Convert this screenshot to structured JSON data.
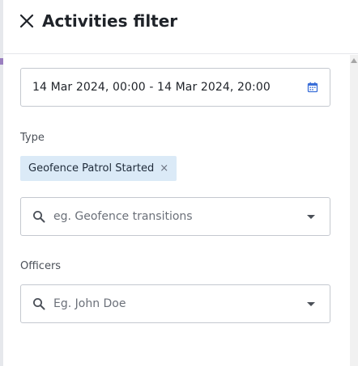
{
  "header": {
    "title": "Activities filter",
    "close_icon": "close-icon"
  },
  "date_range": {
    "value": "14 Mar 2024, 00:00 - 14 Mar 2024, 20:00",
    "icon": "calendar-icon",
    "icon_color": "#3b6fd8"
  },
  "type_section": {
    "label": "Type",
    "chips": [
      {
        "label": "Geofence Patrol Started",
        "remove": "×"
      }
    ],
    "search": {
      "placeholder": "eg. Geofence transitions",
      "icon": "search-icon"
    }
  },
  "officers_section": {
    "label": "Officers",
    "search": {
      "placeholder": "Eg. John Doe",
      "icon": "search-icon"
    }
  },
  "colors": {
    "chip_bg": "#dbeaf7",
    "border": "#c4c8cf",
    "text": "#1f2329"
  }
}
